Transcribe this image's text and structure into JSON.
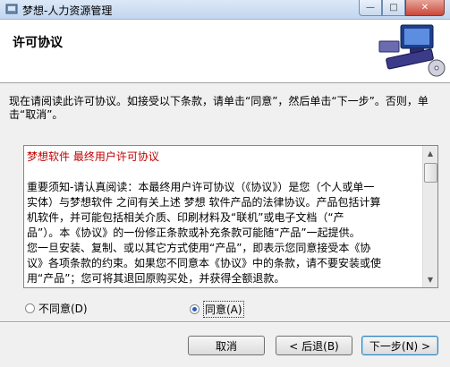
{
  "window": {
    "title": "梦想-人力资源管理",
    "controls": {
      "minimize": "—",
      "maximize": "□",
      "close": "✕"
    }
  },
  "header": {
    "heading": "许可协议"
  },
  "instruction": "现在请阅读此许可协议。如接受以下条款，请单击“同意”，然后单击“下一步”。否则，单击“取消”。",
  "license": {
    "title": "梦想软件 最终用户许可协议",
    "body": [
      "重要须知-请认真阅读：本最终用户许可协议（《协议》）是您（个人或单一",
      "实体）与梦想软件 之间有关上述 梦想 软件产品的法律协议。产品包括计算",
      "机软件，并可能包括相关介质、印刷材料及“联机”或电子文档（“产",
      "品”）。本《协议》的一份修正条款或补充条款可能随“产品”一起提供。",
      "您一旦安装、复制、或以其它方式使用“产品”，即表示您同意接受本《协",
      "议》各项条款的约束。如果您不同意本《协议》中的条款，请不要安装或使",
      "用“产品”；您可将其退回原购买处，并获得全额退款。"
    ]
  },
  "options": {
    "disagree": {
      "label": "不同意(D)",
      "selected": false
    },
    "agree": {
      "label": "同意(A)",
      "selected": true
    }
  },
  "buttons": {
    "cancel": "取消",
    "back": "< 后退(B)",
    "next": "下一步(N) >"
  }
}
